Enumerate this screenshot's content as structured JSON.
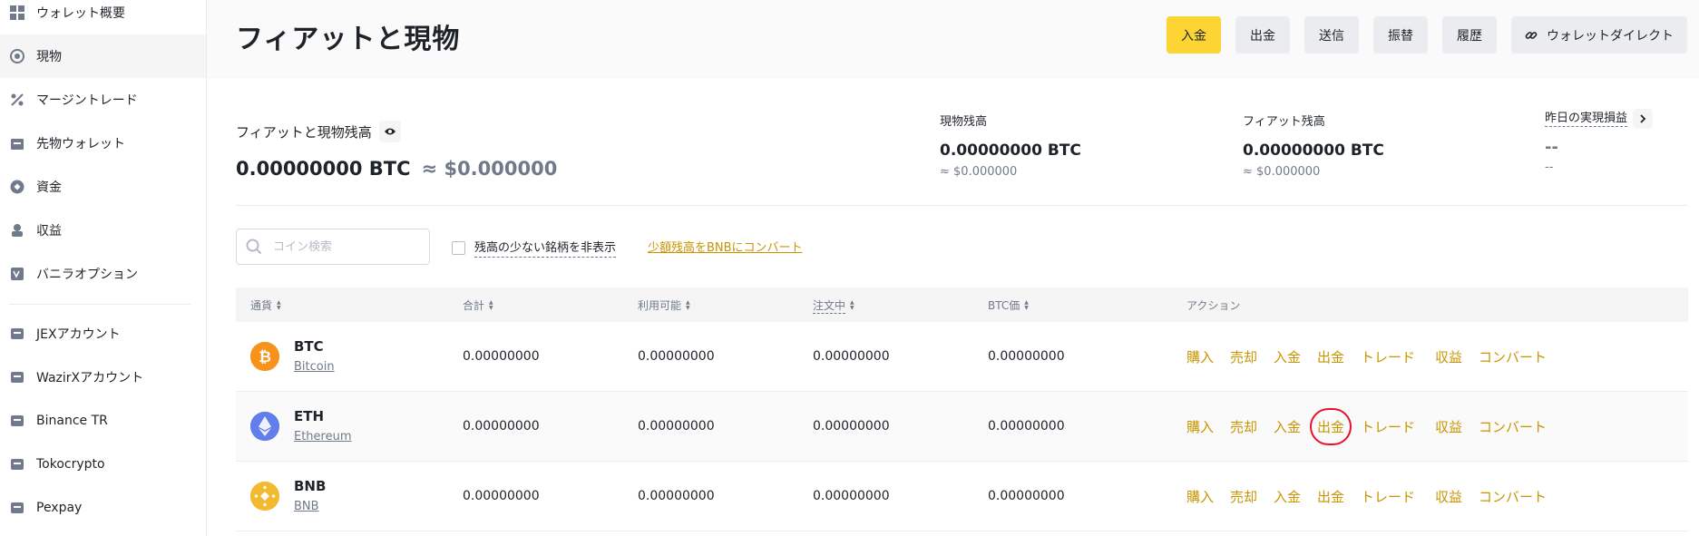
{
  "sidebar": {
    "items": [
      {
        "label": "ウォレット概要",
        "icon": "grid-icon"
      },
      {
        "label": "現物",
        "icon": "spot-icon"
      },
      {
        "label": "マージントレード",
        "icon": "margin-icon"
      },
      {
        "label": "先物ウォレット",
        "icon": "futures-icon"
      },
      {
        "label": "資金",
        "icon": "funding-icon"
      },
      {
        "label": "収益",
        "icon": "earn-icon"
      },
      {
        "label": "バニラオプション",
        "icon": "options-icon"
      },
      {
        "label": "JEXアカウント",
        "icon": "account-icon"
      },
      {
        "label": "WazirXアカウント",
        "icon": "account-icon"
      },
      {
        "label": "Binance TR",
        "icon": "account-icon"
      },
      {
        "label": "Tokocrypto",
        "icon": "account-icon"
      },
      {
        "label": "Pexpay",
        "icon": "account-icon"
      }
    ]
  },
  "header": {
    "title": "フィアットと現物",
    "buttons": {
      "deposit": "入金",
      "withdraw": "出金",
      "send": "送信",
      "transfer": "振替",
      "history": "履歴",
      "wallet_direct": "ウォレットダイレクト"
    }
  },
  "summary": {
    "label": "フィアットと現物残高",
    "btc_value": "0.00000000 BTC",
    "usd_value": "≈ $0.000000",
    "spot": {
      "label": "現物残高",
      "value": "0.00000000 BTC",
      "sub": "≈ $0.000000"
    },
    "fiat": {
      "label": "フィアット残高",
      "value": "0.00000000 BTC",
      "sub": "≈ $0.000000"
    },
    "pnl": {
      "label": "昨日の実現損益",
      "value": "--",
      "sub": "--"
    }
  },
  "filters": {
    "search_placeholder": "コイン検索",
    "hide_small_label": "残高の少ない銘柄を非表示",
    "convert_link": "少額残高をBNBにコンバート"
  },
  "table": {
    "columns": {
      "coin": "通貨",
      "total": "合計",
      "available": "利用可能",
      "in_order": "注文中",
      "btc_value": "BTC価",
      "action": "アクション"
    },
    "rows": [
      {
        "symbol": "BTC",
        "name": "Bitcoin",
        "total": "0.00000000",
        "available": "0.00000000",
        "in_order": "0.00000000",
        "btc_value": "0.00000000",
        "color": "#f7931a"
      },
      {
        "symbol": "ETH",
        "name": "Ethereum",
        "total": "0.00000000",
        "available": "0.00000000",
        "in_order": "0.00000000",
        "btc_value": "0.00000000",
        "color": "#627eea"
      },
      {
        "symbol": "BNB",
        "name": "BNB",
        "total": "0.00000000",
        "available": "0.00000000",
        "in_order": "0.00000000",
        "btc_value": "0.00000000",
        "color": "#f3ba2f"
      }
    ],
    "actions": {
      "buy": "購入",
      "sell": "売却",
      "deposit": "入金",
      "withdraw": "出金",
      "trade": "トレード",
      "earn": "収益",
      "convert": "コンバート"
    }
  },
  "colors": {
    "accent": "#fcd535",
    "link": "#c99400",
    "highlight_circle": "#e8112d"
  }
}
